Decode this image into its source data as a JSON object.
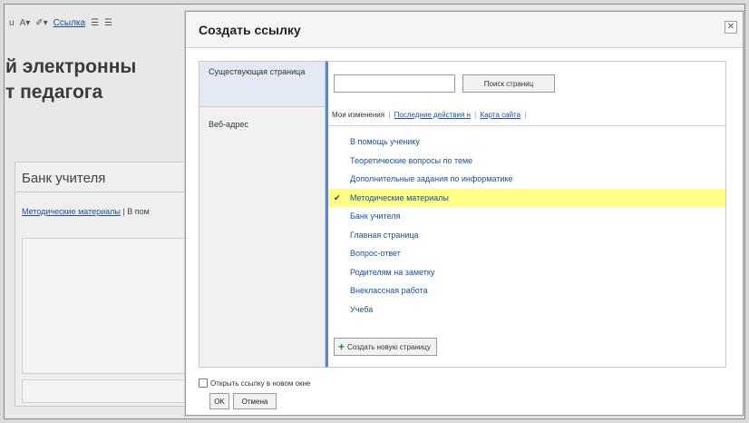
{
  "background": {
    "toolbar": {
      "underline": "u",
      "font_size": "A▾",
      "color": "✐▾",
      "link": "Ссылка",
      "list1": "☰",
      "list2": "☰"
    },
    "title_lines": "й электронны\nт педагога",
    "panel_title": "Банк учителя",
    "breadcrumb_link": "Методические материалы",
    "breadcrumb_rest": " | В пом"
  },
  "dialog": {
    "title": "Создать ссылку",
    "close_glyph": "✕",
    "left_tabs": [
      "Существующая страница",
      "Веб-адрес"
    ],
    "search": {
      "value": "",
      "button": "Поиск страниц"
    },
    "tabs": {
      "current": "Мои изменения",
      "recent": "Последние действия н",
      "sitemap": "Карта сайта"
    },
    "pages": [
      "В помощь ученику",
      "Теоретические вопросы по теме",
      "Дополнительные задания по информатике",
      "Методические материалы",
      "Банк учителя",
      "Главная страница",
      "Вопрос-ответ",
      "Родителям на заметку",
      "Внеклассная работа",
      "Учеба"
    ],
    "selected_check": "✔",
    "new_page_button": "Создать новую страницу",
    "open_new_window": "Открыть ссылку в новом окне",
    "ok": "OK",
    "cancel": "Отмена"
  }
}
